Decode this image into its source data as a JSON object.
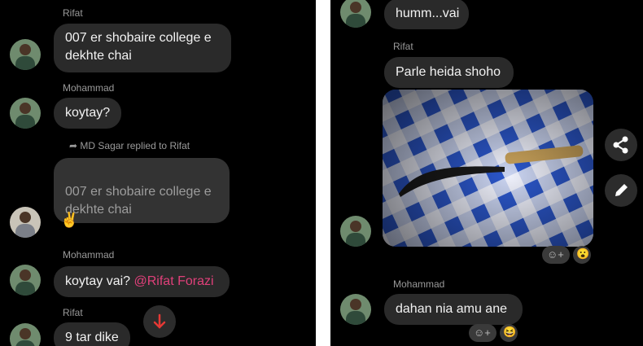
{
  "left": {
    "messages": [
      {
        "sender": "Rifat",
        "text": "007 er shobaire college e\ndekhte chai"
      },
      {
        "sender": "Mohammad",
        "text": "koytay?"
      },
      {
        "reply_note": "MD Sagar replied to Rifat",
        "quoted": "007 er shobaire college e\ndekhte chai",
        "emoji": "✌️"
      },
      {
        "sender": "Mohammad",
        "text": "koytay vai?",
        "mention": "@Rifat Forazi"
      },
      {
        "sender": "Rifat",
        "text": "9 tar dike"
      }
    ],
    "scroll_down_icon": "arrow-down-icon"
  },
  "right": {
    "messages": [
      {
        "text": "humm...vai"
      },
      {
        "sender": "Rifat",
        "text": "Parle heida shoho"
      },
      {
        "sender": "Mohammad",
        "text": "dahan nia amu ane"
      }
    ],
    "side_actions": [
      "share-icon",
      "edit-icon"
    ],
    "reaction_emoji": "😮",
    "reaction_emoji2": "😆"
  },
  "colors": {
    "mention": "#e0407a",
    "bubble": "#2a2a2a",
    "background": "#000000"
  }
}
